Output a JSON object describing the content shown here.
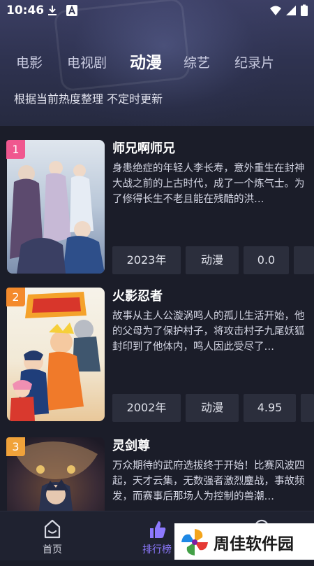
{
  "status_bar": {
    "time": "10:46",
    "icons": [
      "download-icon",
      "text-a-icon",
      "wifi-icon",
      "signal-icon",
      "battery-icon"
    ]
  },
  "tabs": [
    {
      "label": "电影",
      "active": false
    },
    {
      "label": "电视剧",
      "active": false
    },
    {
      "label": "动漫",
      "active": true
    },
    {
      "label": "综艺",
      "active": false
    },
    {
      "label": "纪录片",
      "active": false
    }
  ],
  "subtitle": "根据当前热度整理 不定时更新",
  "items": [
    {
      "rank": "1",
      "title": "师兄啊师兄",
      "description": "身患绝症的年轻人李长寿，意外重生在封神大战之前的上古时代，成了一个炼气士。为了修得长生不老且能在残酷的洪…",
      "year": "2023年",
      "genre": "动漫",
      "score": "0.0"
    },
    {
      "rank": "2",
      "title": "火影忍者",
      "description": "故事从主人公漩涡鸣人的孤儿生活开始，他的父母为了保护村子，将攻击村子九尾妖狐封印到了他体内，鸣人因此受尽了…",
      "year": "2002年",
      "genre": "动漫",
      "score": "4.95"
    },
    {
      "rank": "3",
      "title": "灵剑尊",
      "description": "万众期待的武府选拔终于开始！比赛风波四起，天才云集，无数强者激烈鏖战，事故频发，而赛事后那场人为控制的兽潮…",
      "year": "",
      "genre": "",
      "score": ""
    }
  ],
  "bottom_nav": [
    {
      "label": "首页",
      "icon": "home-smile-icon",
      "active": false
    },
    {
      "label": "排行榜",
      "icon": "thumbs-up-icon",
      "active": true
    },
    {
      "label": "",
      "icon": "profile-icon",
      "active": false
    }
  ],
  "watermark": {
    "text": "周佳软件园"
  },
  "colors": {
    "background": "#1b1d29",
    "accent": "#8d79ff",
    "rank1": "#f0578f",
    "rank2": "#f48a2c",
    "rank3": "#f0a23a"
  }
}
